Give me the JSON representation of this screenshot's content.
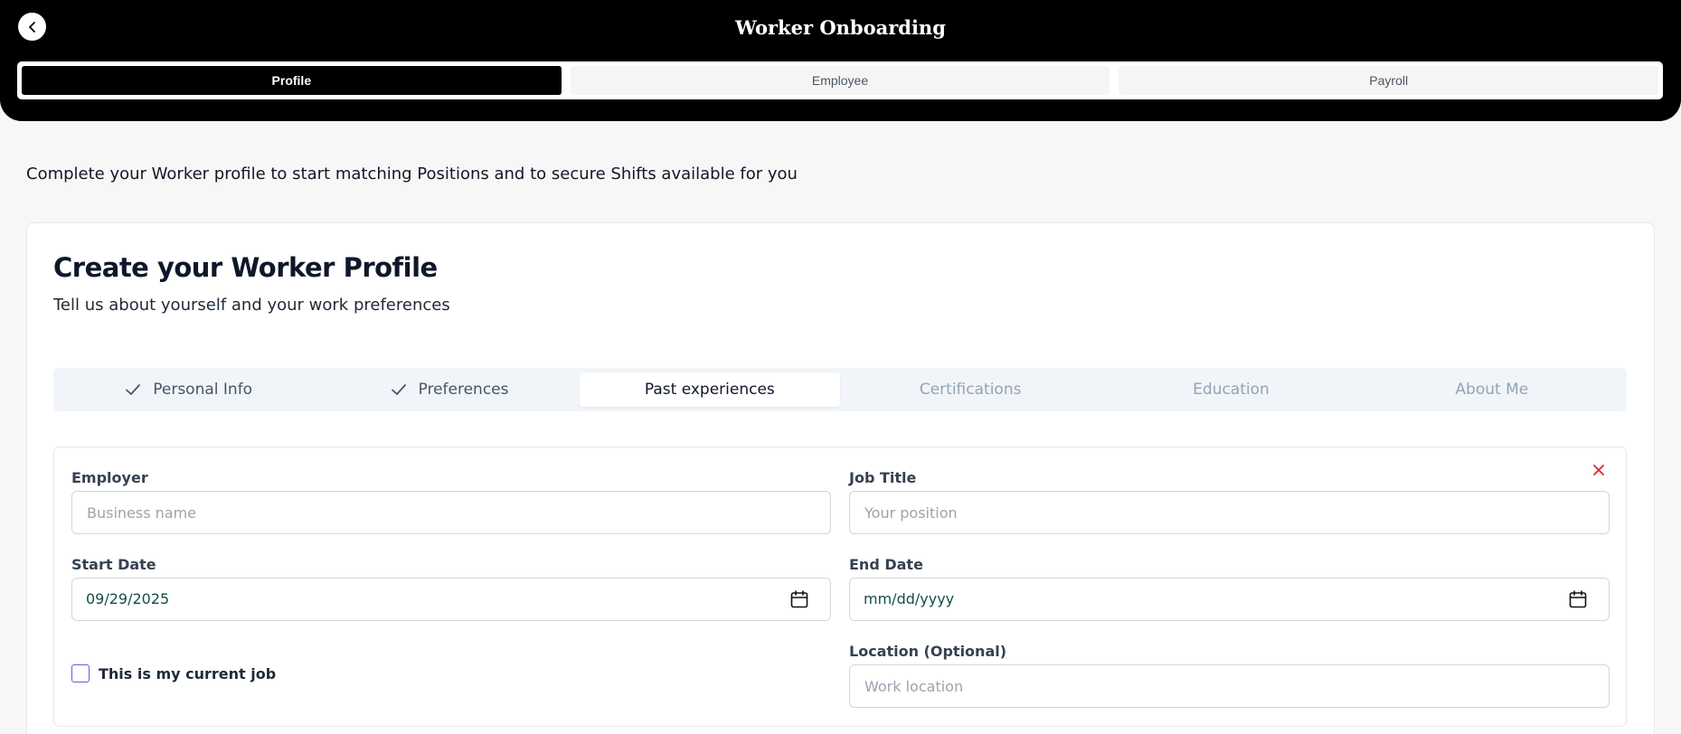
{
  "header": {
    "title": "Worker Onboarding",
    "tabs": [
      {
        "label": "Profile",
        "active": true
      },
      {
        "label": "Employee",
        "active": false
      },
      {
        "label": "Payroll",
        "active": false
      }
    ]
  },
  "intro_text": "Complete your Worker profile to start matching Positions and to secure Shifts available for you",
  "card": {
    "title": "Create your Worker Profile",
    "subtitle": "Tell us about yourself and your work preferences"
  },
  "steps": [
    {
      "label": "Personal Info",
      "status": "done"
    },
    {
      "label": "Preferences",
      "status": "done"
    },
    {
      "label": "Past experiences",
      "status": "active"
    },
    {
      "label": "Certifications",
      "status": "pending"
    },
    {
      "label": "Education",
      "status": "pending"
    },
    {
      "label": "About Me",
      "status": "pending"
    }
  ],
  "form": {
    "employer": {
      "label": "Employer",
      "placeholder": "Business name",
      "value": ""
    },
    "job_title": {
      "label": "Job Title",
      "placeholder": "Your position",
      "value": ""
    },
    "start_date": {
      "label": "Start Date",
      "value": "09/29/2025"
    },
    "end_date": {
      "label": "End Date",
      "value": "mm/dd/yyyy"
    },
    "location": {
      "label": "Location (Optional)",
      "placeholder": "Work location",
      "value": ""
    },
    "current_job": {
      "label": "This is my current job",
      "checked": false
    }
  },
  "colors": {
    "header_bg": "#000000",
    "page_bg": "#f7f7f7",
    "remove_icon": "#dc2626",
    "checkbox_border": "#6d5bd0"
  }
}
